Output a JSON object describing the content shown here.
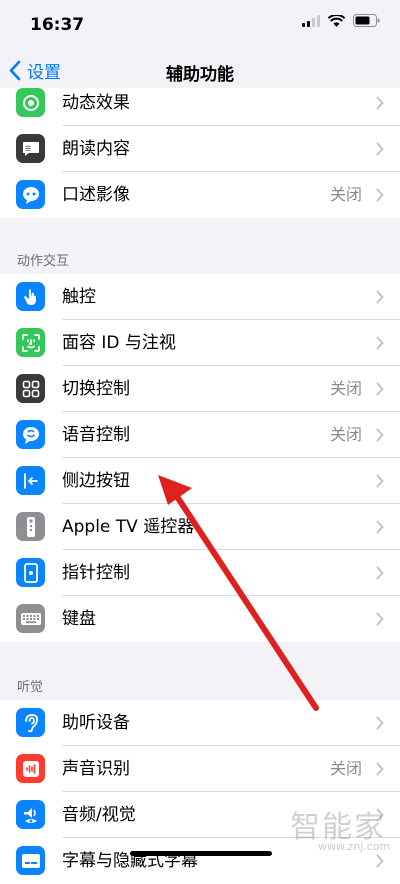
{
  "status_bar": {
    "time": "16:37"
  },
  "nav": {
    "back_label": "设置",
    "title": "辅助功能"
  },
  "groups": [
    {
      "rows": [
        {
          "label": "动态效果",
          "value": "",
          "icon": "motion-icon",
          "color": "#34c759"
        },
        {
          "label": "朗读内容",
          "value": "",
          "icon": "speech-bubble-icon",
          "color": "#3a3a3c"
        },
        {
          "label": "口述影像",
          "value": "关闭",
          "icon": "audio-description-icon",
          "color": "#0a84ff"
        }
      ]
    },
    {
      "header": "动作交互",
      "rows": [
        {
          "label": "触控",
          "value": "",
          "icon": "hand-touch-icon",
          "color": "#0a84ff"
        },
        {
          "label": "面容 ID 与注视",
          "value": "",
          "icon": "face-id-icon",
          "color": "#34c759"
        },
        {
          "label": "切换控制",
          "value": "关闭",
          "icon": "switch-control-icon",
          "color": "#3a3a3c"
        },
        {
          "label": "语音控制",
          "value": "关闭",
          "icon": "voice-control-icon",
          "color": "#0a84ff"
        },
        {
          "label": "侧边按钮",
          "value": "",
          "icon": "side-button-icon",
          "color": "#0a84ff"
        },
        {
          "label": "Apple TV 遥控器",
          "value": "",
          "icon": "remote-icon",
          "color": "#8e8e93"
        },
        {
          "label": "指针控制",
          "value": "",
          "icon": "pointer-control-icon",
          "color": "#0a84ff"
        },
        {
          "label": "键盘",
          "value": "",
          "icon": "keyboard-icon",
          "color": "#8e8e93"
        }
      ]
    },
    {
      "header": "听觉",
      "rows": [
        {
          "label": "助听设备",
          "value": "",
          "icon": "ear-icon",
          "color": "#0a84ff"
        },
        {
          "label": "声音识别",
          "value": "关闭",
          "icon": "sound-recognition-icon",
          "color": "#ff3b30"
        },
        {
          "label": "音频/视觉",
          "value": "",
          "icon": "audio-visual-icon",
          "color": "#0a84ff"
        },
        {
          "label": "字幕与隐藏式字幕",
          "value": "",
          "icon": "subtitles-icon",
          "color": "#0a84ff"
        }
      ]
    }
  ],
  "watermark": {
    "text": "智能家",
    "url": "www.znj.com"
  },
  "annotation": {
    "color": "#e0201f"
  }
}
